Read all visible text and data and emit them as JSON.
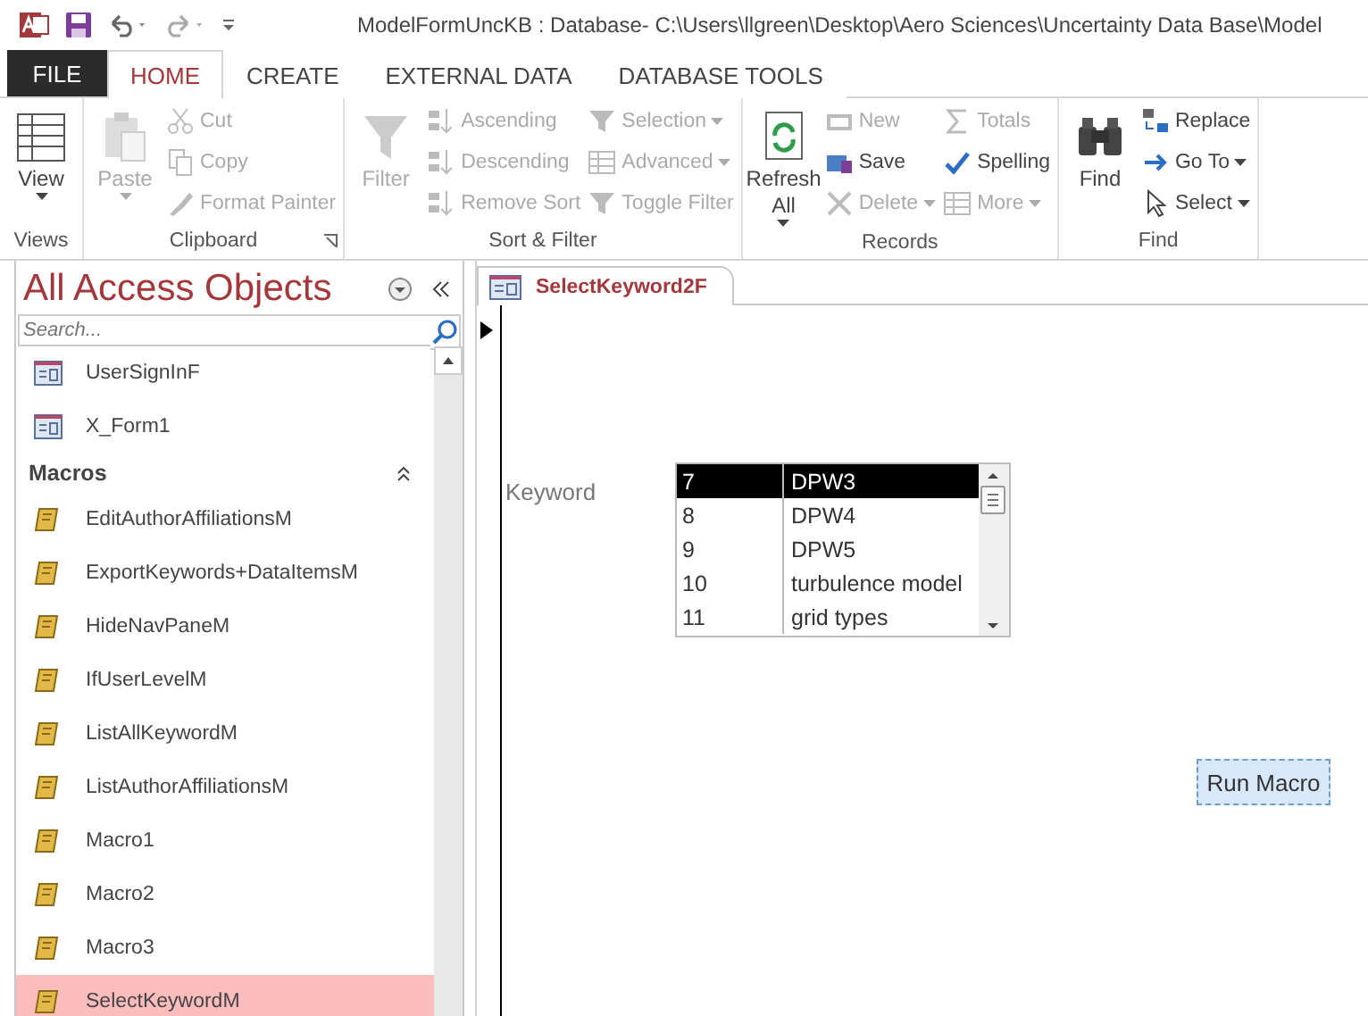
{
  "title_bar": {
    "title": "ModelFormUncKB : Database- C:\\Users\\llgreen\\Desktop\\Aero Sciences\\Uncertainty Data Base\\Model"
  },
  "menu_tabs": [
    {
      "label": "FILE",
      "kind": "file",
      "selected": false
    },
    {
      "label": "HOME",
      "kind": "tab",
      "selected": true
    },
    {
      "label": "CREATE",
      "kind": "tab",
      "selected": false
    },
    {
      "label": "EXTERNAL DATA",
      "kind": "tab",
      "selected": false
    },
    {
      "label": "DATABASE TOOLS",
      "kind": "tab",
      "selected": false
    }
  ],
  "ribbon": [
    {
      "label": "Views",
      "launcher": false,
      "large": [
        {
          "label": "View",
          "disabled": false,
          "dropdown": true
        }
      ]
    },
    {
      "label": "Clipboard",
      "launcher": true,
      "large": [
        {
          "label": "Paste",
          "disabled": true,
          "dropdown": true
        }
      ],
      "columns": [
        [
          {
            "label": "Cut",
            "disabled": true,
            "dropdown": false
          },
          {
            "label": "Copy",
            "disabled": true,
            "dropdown": false
          },
          {
            "label": "Format Painter",
            "disabled": true,
            "dropdown": false
          }
        ]
      ]
    },
    {
      "label": "Sort & Filter",
      "launcher": false,
      "large": [
        {
          "label": "Filter",
          "disabled": true,
          "dropdown": false
        }
      ],
      "columns": [
        [
          {
            "label": "Ascending",
            "disabled": true,
            "dropdown": false
          },
          {
            "label": "Descending",
            "disabled": true,
            "dropdown": false
          },
          {
            "label": "Remove Sort",
            "disabled": true,
            "dropdown": false
          }
        ],
        [
          {
            "label": "Selection",
            "disabled": true,
            "dropdown": true
          },
          {
            "label": "Advanced",
            "disabled": true,
            "dropdown": true
          },
          {
            "label": "Toggle Filter",
            "disabled": true,
            "dropdown": false
          }
        ]
      ]
    },
    {
      "label": "Records",
      "launcher": false,
      "large": [
        {
          "label": "Refresh All",
          "disabled": false,
          "dropdown": true
        }
      ],
      "columns": [
        [
          {
            "label": "New",
            "disabled": true,
            "dropdown": false
          },
          {
            "label": "Save",
            "disabled": false,
            "dropdown": false
          },
          {
            "label": "Delete",
            "disabled": true,
            "dropdown": true
          }
        ],
        [
          {
            "label": "Totals",
            "disabled": true,
            "dropdown": false
          },
          {
            "label": "Spelling",
            "disabled": false,
            "dropdown": false
          },
          {
            "label": "More",
            "disabled": true,
            "dropdown": true
          }
        ]
      ]
    },
    {
      "label": "Find",
      "launcher": false,
      "large": [
        {
          "label": "Find",
          "disabled": false,
          "dropdown": false
        }
      ],
      "columns": [
        [
          {
            "label": "Replace",
            "disabled": false,
            "dropdown": false
          },
          {
            "label": "Go To",
            "disabled": false,
            "dropdown": true
          },
          {
            "label": "Select",
            "disabled": false,
            "dropdown": true
          }
        ]
      ]
    }
  ],
  "nav_pane": {
    "title": "All Access Objects",
    "search": {
      "placeholder": "Search..."
    },
    "forms": [
      {
        "label": "UserSignInF",
        "selected": false
      },
      {
        "label": "X_Form1",
        "selected": false
      }
    ],
    "macros": {
      "label": "Macros",
      "expanded": true,
      "items": [
        {
          "label": "EditAuthorAffiliationsM",
          "selected": false
        },
        {
          "label": "ExportKeywords+DataItemsM",
          "selected": false
        },
        {
          "label": "HideNavPaneM",
          "selected": false
        },
        {
          "label": "IfUserLevelM",
          "selected": false
        },
        {
          "label": "ListAllKeywordM",
          "selected": false
        },
        {
          "label": "ListAuthorAffiliationsM",
          "selected": false
        },
        {
          "label": "Macro1",
          "selected": false
        },
        {
          "label": "Macro2",
          "selected": false
        },
        {
          "label": "Macro3",
          "selected": false
        },
        {
          "label": "SelectKeywordM",
          "selected": true
        }
      ]
    }
  },
  "document_tab": {
    "label": "SelectKeyword2F",
    "selected": true
  },
  "form": {
    "keyword_label": "Keyword",
    "keyword_list": [
      {
        "id": "7",
        "name": "DPW3",
        "selected": true
      },
      {
        "id": "8",
        "name": "DPW4",
        "selected": false
      },
      {
        "id": "9",
        "name": "DPW5",
        "selected": false
      },
      {
        "id": "10",
        "name": "turbulence model",
        "selected": false
      },
      {
        "id": "11",
        "name": "grid types",
        "selected": false
      }
    ],
    "run_button": "Run Macro"
  }
}
